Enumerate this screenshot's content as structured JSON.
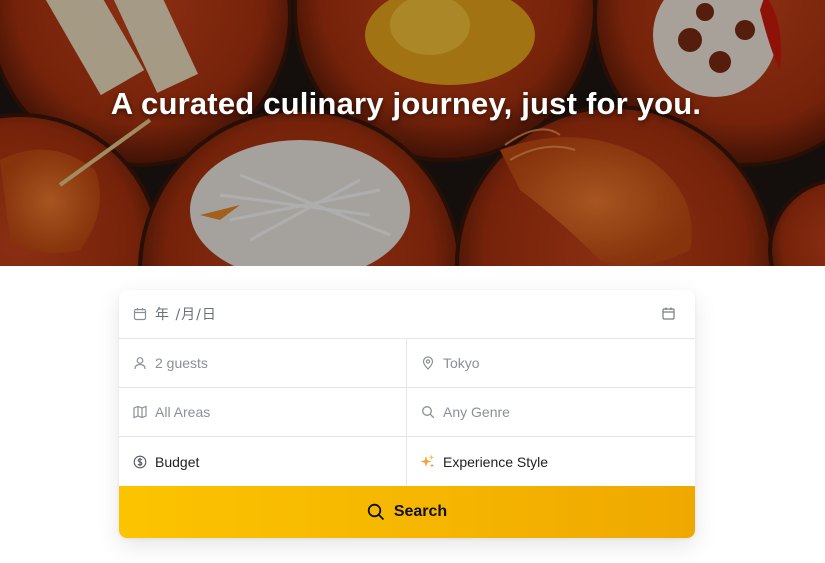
{
  "hero": {
    "title": "A curated culinary journey, just for you."
  },
  "form": {
    "date": {
      "placeholder": "年 /月/日",
      "icon": "calendar-icon"
    },
    "guests": {
      "value": "2 guests",
      "icon": "person-icon"
    },
    "location": {
      "value": "Tokyo",
      "icon": "map-pin-icon"
    },
    "area": {
      "value": "All Areas",
      "icon": "map-icon"
    },
    "genre": {
      "value": "Any Genre",
      "icon": "search-icon"
    },
    "budget": {
      "value": "Budget",
      "icon": "dollar-circle-icon"
    },
    "style": {
      "value": "Experience Style",
      "icon": "sparkles-icon"
    },
    "search_label": "Search"
  },
  "colors": {
    "accent": "#f7b900",
    "border": "#e6e6e6",
    "muted_text": "#8a8f98"
  }
}
